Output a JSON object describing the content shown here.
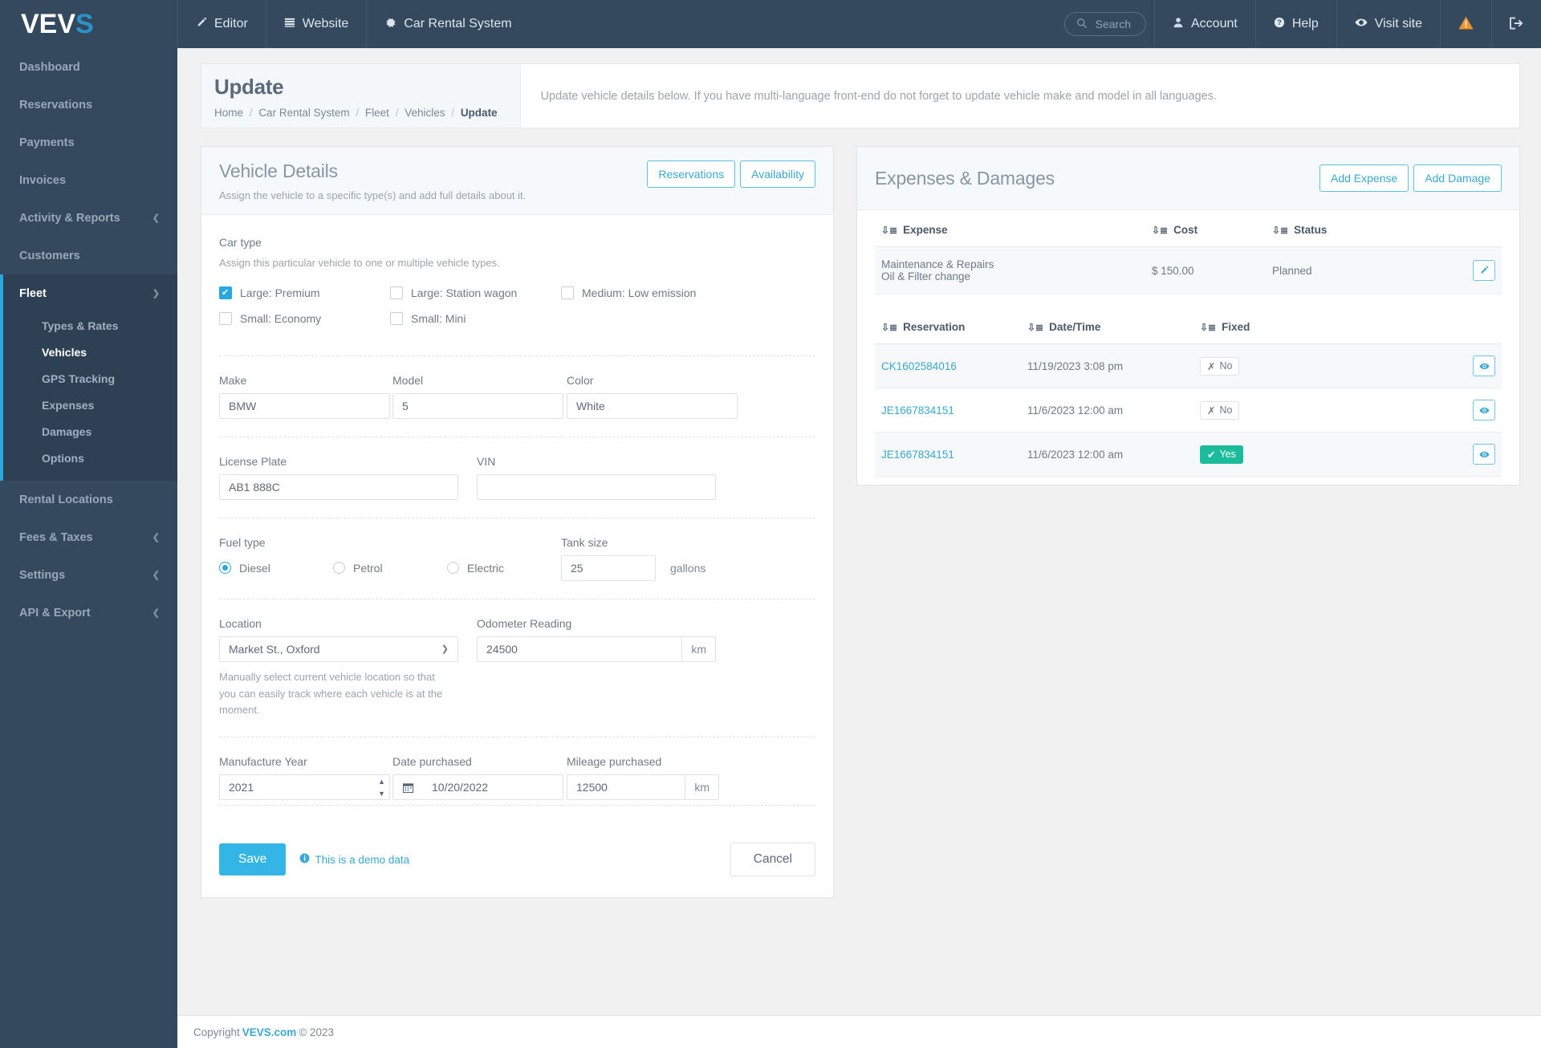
{
  "topnav": {
    "brand": "VEVS",
    "brand_main": "VEV",
    "brand_accent": "S",
    "items": [
      {
        "label": "Editor",
        "icon": "pencil-icon"
      },
      {
        "label": "Website",
        "icon": "list-icon"
      },
      {
        "label": "Car Rental System",
        "icon": "gear-icon"
      }
    ],
    "search_placeholder": "Search",
    "account": "Account",
    "help": "Help",
    "visit_site": "Visit site",
    "warning_icon": "warning-icon",
    "logout_icon": "logout-icon",
    "accent_color": "#29a8e0",
    "bg_color": "#34495e"
  },
  "sidebar": {
    "items": [
      {
        "label": "Dashboard",
        "expandable": false
      },
      {
        "label": "Reservations",
        "expandable": false
      },
      {
        "label": "Payments",
        "expandable": false
      },
      {
        "label": "Invoices",
        "expandable": false
      },
      {
        "label": "Activity & Reports",
        "expandable": true
      },
      {
        "label": "Customers",
        "expandable": false
      }
    ],
    "group": {
      "label": "Fleet",
      "sub_items": [
        {
          "label": "Types & Rates",
          "active": false
        },
        {
          "label": "Vehicles",
          "active": true
        },
        {
          "label": "GPS Tracking",
          "active": false
        },
        {
          "label": "Expenses",
          "active": false
        },
        {
          "label": "Damages",
          "active": false
        },
        {
          "label": "Options",
          "active": false
        }
      ]
    },
    "items_after": [
      {
        "label": "Rental Locations",
        "expandable": false
      },
      {
        "label": "Fees & Taxes",
        "expandable": true
      },
      {
        "label": "Settings",
        "expandable": true
      },
      {
        "label": "API & Export",
        "expandable": true
      }
    ]
  },
  "pagehead": {
    "title": "Update",
    "breadcrumb": [
      "Home",
      "Car Rental System",
      "Fleet",
      "Vehicles"
    ],
    "breadcrumb_current": "Update",
    "description": "Update vehicle details below. If you have multi-language front-end do not forget to update vehicle make and model in all languages."
  },
  "vehicle_details": {
    "title": "Vehicle Details",
    "subtitle": "Assign the vehicle to a specific type(s) and add full details about it.",
    "btn_reservations": "Reservations",
    "btn_availability": "Availability",
    "car_type": {
      "label": "Car type",
      "hint": "Assign this particular vehicle to one or multiple vehicle types.",
      "options": [
        {
          "label": "Large: Premium",
          "checked": true
        },
        {
          "label": "Large: Station wagon",
          "checked": false
        },
        {
          "label": "Medium: Low emission",
          "checked": false
        },
        {
          "label": "Small: Economy",
          "checked": false
        },
        {
          "label": "Small: Mini",
          "checked": false
        }
      ]
    },
    "make": {
      "label": "Make",
      "value": "BMW"
    },
    "model": {
      "label": "Model",
      "value": "5"
    },
    "color": {
      "label": "Color",
      "value": "White"
    },
    "license_plate": {
      "label": "License Plate",
      "value": "AB1 888C"
    },
    "vin": {
      "label": "VIN",
      "value": ""
    },
    "fuel_type": {
      "label": "Fuel type",
      "options": [
        {
          "label": "Diesel",
          "selected": true
        },
        {
          "label": "Petrol",
          "selected": false
        },
        {
          "label": "Electric",
          "selected": false
        }
      ]
    },
    "tank_size": {
      "label": "Tank size",
      "value": "25",
      "unit": "gallons"
    },
    "location": {
      "label": "Location",
      "value": "Market St., Oxford",
      "hint": "Manually select current vehicle location so that you can easily track where each vehicle is at the moment."
    },
    "odometer": {
      "label": "Odometer Reading",
      "value": "24500",
      "unit": "km"
    },
    "manufacture_year": {
      "label": "Manufacture Year",
      "value": "2021"
    },
    "date_purchased": {
      "label": "Date purchased",
      "value": "10/20/2022",
      "icon": "calendar-icon"
    },
    "mileage_purchased": {
      "label": "Mileage purchased",
      "value": "12500",
      "unit": "km"
    },
    "save_label": "Save",
    "demo_note": "This is a demo data",
    "cancel_label": "Cancel"
  },
  "expenses_damages": {
    "title": "Expenses & Damages",
    "btn_add_expense": "Add Expense",
    "btn_add_damage": "Add Damage",
    "expense_table": {
      "columns": [
        "Expense",
        "Cost",
        "Status"
      ],
      "rows": [
        {
          "expense_line1": "Maintenance & Repairs",
          "expense_line2": "Oil & Filter change",
          "cost": "$ 150.00",
          "status": "Planned",
          "action_icon": "pencil-icon"
        }
      ]
    },
    "damage_table": {
      "columns": [
        "Reservation",
        "Date/Time",
        "Fixed"
      ],
      "rows": [
        {
          "reservation": "CK1602584016",
          "datetime": "11/19/2023 3:08 pm",
          "fixed": "No",
          "fixed_state": false,
          "action_icon": "eye-icon"
        },
        {
          "reservation": "JE1667834151",
          "datetime": "11/6/2023 12:00 am",
          "fixed": "No",
          "fixed_state": false,
          "action_icon": "eye-icon"
        },
        {
          "reservation": "JE1667834151",
          "datetime": "11/6/2023 12:00 am",
          "fixed": "Yes",
          "fixed_state": true,
          "action_icon": "eye-icon"
        }
      ]
    }
  },
  "footer": {
    "prefix": "Copyright",
    "brand": "VEVS.com",
    "suffix": "© 2023"
  }
}
